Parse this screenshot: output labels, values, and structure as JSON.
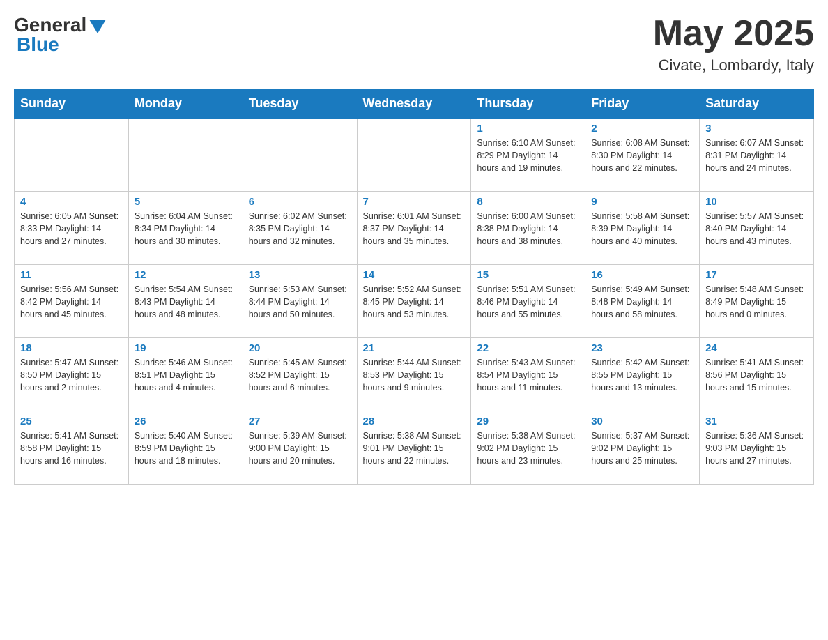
{
  "header": {
    "logo": {
      "general": "General",
      "blue": "Blue"
    },
    "title": "May 2025",
    "location": "Civate, Lombardy, Italy"
  },
  "weekdays": [
    "Sunday",
    "Monday",
    "Tuesday",
    "Wednesday",
    "Thursday",
    "Friday",
    "Saturday"
  ],
  "weeks": [
    [
      {
        "day": "",
        "info": ""
      },
      {
        "day": "",
        "info": ""
      },
      {
        "day": "",
        "info": ""
      },
      {
        "day": "",
        "info": ""
      },
      {
        "day": "1",
        "info": "Sunrise: 6:10 AM\nSunset: 8:29 PM\nDaylight: 14 hours and 19 minutes."
      },
      {
        "day": "2",
        "info": "Sunrise: 6:08 AM\nSunset: 8:30 PM\nDaylight: 14 hours and 22 minutes."
      },
      {
        "day": "3",
        "info": "Sunrise: 6:07 AM\nSunset: 8:31 PM\nDaylight: 14 hours and 24 minutes."
      }
    ],
    [
      {
        "day": "4",
        "info": "Sunrise: 6:05 AM\nSunset: 8:33 PM\nDaylight: 14 hours and 27 minutes."
      },
      {
        "day": "5",
        "info": "Sunrise: 6:04 AM\nSunset: 8:34 PM\nDaylight: 14 hours and 30 minutes."
      },
      {
        "day": "6",
        "info": "Sunrise: 6:02 AM\nSunset: 8:35 PM\nDaylight: 14 hours and 32 minutes."
      },
      {
        "day": "7",
        "info": "Sunrise: 6:01 AM\nSunset: 8:37 PM\nDaylight: 14 hours and 35 minutes."
      },
      {
        "day": "8",
        "info": "Sunrise: 6:00 AM\nSunset: 8:38 PM\nDaylight: 14 hours and 38 minutes."
      },
      {
        "day": "9",
        "info": "Sunrise: 5:58 AM\nSunset: 8:39 PM\nDaylight: 14 hours and 40 minutes."
      },
      {
        "day": "10",
        "info": "Sunrise: 5:57 AM\nSunset: 8:40 PM\nDaylight: 14 hours and 43 minutes."
      }
    ],
    [
      {
        "day": "11",
        "info": "Sunrise: 5:56 AM\nSunset: 8:42 PM\nDaylight: 14 hours and 45 minutes."
      },
      {
        "day": "12",
        "info": "Sunrise: 5:54 AM\nSunset: 8:43 PM\nDaylight: 14 hours and 48 minutes."
      },
      {
        "day": "13",
        "info": "Sunrise: 5:53 AM\nSunset: 8:44 PM\nDaylight: 14 hours and 50 minutes."
      },
      {
        "day": "14",
        "info": "Sunrise: 5:52 AM\nSunset: 8:45 PM\nDaylight: 14 hours and 53 minutes."
      },
      {
        "day": "15",
        "info": "Sunrise: 5:51 AM\nSunset: 8:46 PM\nDaylight: 14 hours and 55 minutes."
      },
      {
        "day": "16",
        "info": "Sunrise: 5:49 AM\nSunset: 8:48 PM\nDaylight: 14 hours and 58 minutes."
      },
      {
        "day": "17",
        "info": "Sunrise: 5:48 AM\nSunset: 8:49 PM\nDaylight: 15 hours and 0 minutes."
      }
    ],
    [
      {
        "day": "18",
        "info": "Sunrise: 5:47 AM\nSunset: 8:50 PM\nDaylight: 15 hours and 2 minutes."
      },
      {
        "day": "19",
        "info": "Sunrise: 5:46 AM\nSunset: 8:51 PM\nDaylight: 15 hours and 4 minutes."
      },
      {
        "day": "20",
        "info": "Sunrise: 5:45 AM\nSunset: 8:52 PM\nDaylight: 15 hours and 6 minutes."
      },
      {
        "day": "21",
        "info": "Sunrise: 5:44 AM\nSunset: 8:53 PM\nDaylight: 15 hours and 9 minutes."
      },
      {
        "day": "22",
        "info": "Sunrise: 5:43 AM\nSunset: 8:54 PM\nDaylight: 15 hours and 11 minutes."
      },
      {
        "day": "23",
        "info": "Sunrise: 5:42 AM\nSunset: 8:55 PM\nDaylight: 15 hours and 13 minutes."
      },
      {
        "day": "24",
        "info": "Sunrise: 5:41 AM\nSunset: 8:56 PM\nDaylight: 15 hours and 15 minutes."
      }
    ],
    [
      {
        "day": "25",
        "info": "Sunrise: 5:41 AM\nSunset: 8:58 PM\nDaylight: 15 hours and 16 minutes."
      },
      {
        "day": "26",
        "info": "Sunrise: 5:40 AM\nSunset: 8:59 PM\nDaylight: 15 hours and 18 minutes."
      },
      {
        "day": "27",
        "info": "Sunrise: 5:39 AM\nSunset: 9:00 PM\nDaylight: 15 hours and 20 minutes."
      },
      {
        "day": "28",
        "info": "Sunrise: 5:38 AM\nSunset: 9:01 PM\nDaylight: 15 hours and 22 minutes."
      },
      {
        "day": "29",
        "info": "Sunrise: 5:38 AM\nSunset: 9:02 PM\nDaylight: 15 hours and 23 minutes."
      },
      {
        "day": "30",
        "info": "Sunrise: 5:37 AM\nSunset: 9:02 PM\nDaylight: 15 hours and 25 minutes."
      },
      {
        "day": "31",
        "info": "Sunrise: 5:36 AM\nSunset: 9:03 PM\nDaylight: 15 hours and 27 minutes."
      }
    ]
  ]
}
